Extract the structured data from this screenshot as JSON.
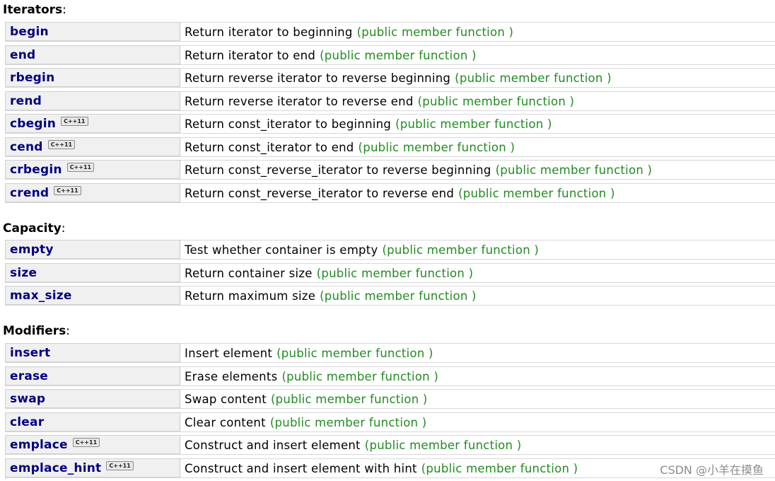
{
  "sections": [
    {
      "title": "Iterators",
      "colon": ":",
      "rows": [
        {
          "name": "begin",
          "desc": "Return iterator to beginning",
          "kind": "(public member function )",
          "badge": ""
        },
        {
          "name": "end",
          "desc": "Return iterator to end",
          "kind": "(public member function )",
          "badge": ""
        },
        {
          "name": "rbegin",
          "desc": "Return reverse iterator to reverse beginning",
          "kind": "(public member function )",
          "badge": ""
        },
        {
          "name": "rend",
          "desc": "Return reverse iterator to reverse end",
          "kind": "(public member function )",
          "badge": ""
        },
        {
          "name": "cbegin",
          "desc": "Return const_iterator to beginning",
          "kind": "(public member function )",
          "badge": "C++11"
        },
        {
          "name": "cend",
          "desc": "Return const_iterator to end",
          "kind": "(public member function )",
          "badge": "C++11"
        },
        {
          "name": "crbegin",
          "desc": "Return const_reverse_iterator to reverse beginning",
          "kind": "(public member function )",
          "badge": "C++11"
        },
        {
          "name": "crend",
          "desc": "Return const_reverse_iterator to reverse end",
          "kind": "(public member function )",
          "badge": "C++11"
        }
      ]
    },
    {
      "title": "Capacity",
      "colon": ":",
      "rows": [
        {
          "name": "empty",
          "desc": "Test whether container is empty",
          "kind": "(public member function )",
          "badge": ""
        },
        {
          "name": "size",
          "desc": "Return container size",
          "kind": "(public member function )",
          "badge": ""
        },
        {
          "name": "max_size",
          "desc": "Return maximum size",
          "kind": "(public member function )",
          "badge": ""
        }
      ]
    },
    {
      "title": "Modifiers",
      "colon": ":",
      "rows": [
        {
          "name": "insert",
          "desc": "Insert element",
          "kind": "(public member function )",
          "badge": ""
        },
        {
          "name": "erase",
          "desc": "Erase elements",
          "kind": "(public member function )",
          "badge": ""
        },
        {
          "name": "swap",
          "desc": "Swap content",
          "kind": "(public member function )",
          "badge": ""
        },
        {
          "name": "clear",
          "desc": "Clear content",
          "kind": "(public member function )",
          "badge": ""
        },
        {
          "name": "emplace",
          "desc": "Construct and insert element",
          "kind": "(public member function )",
          "badge": "C++11"
        },
        {
          "name": "emplace_hint",
          "desc": "Construct and insert element with hint",
          "kind": "(public member function )",
          "badge": "C++11"
        }
      ]
    }
  ],
  "watermark": "CSDN @小羊在摸鱼",
  "colors": {
    "member_link": "#000080",
    "kind_text": "#228b22",
    "name_cell_bg": "#f0f0f0"
  }
}
